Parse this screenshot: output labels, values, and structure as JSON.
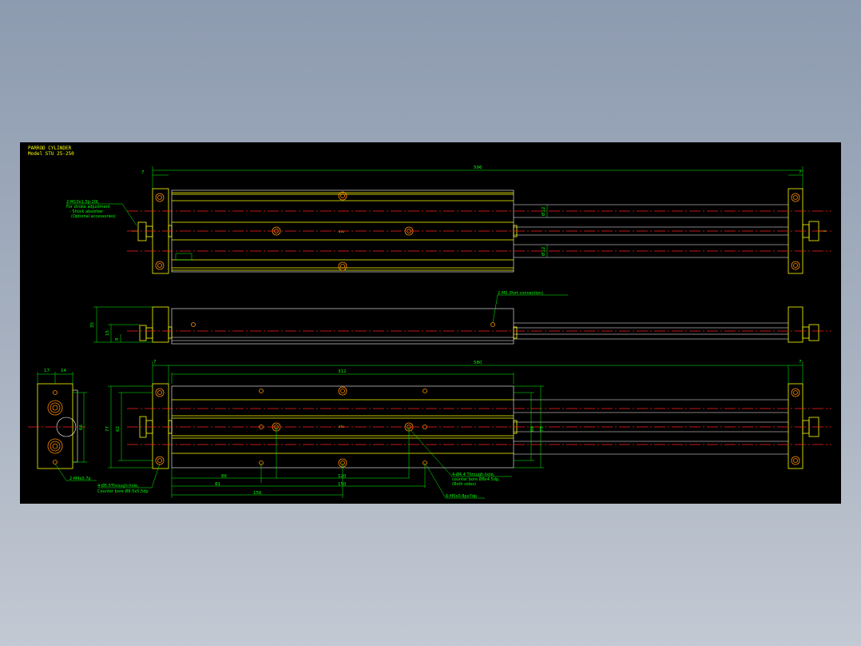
{
  "title": {
    "line1": "PARROD CYLINDER",
    "line2": "Model  STU 25-250"
  },
  "dimensions": {
    "top_overall": "596",
    "top_left_end": "7",
    "top_right_end": "7",
    "top_v1": "Ø12",
    "top_v2": "Ø12",
    "side_h1": "35",
    "side_h2": "15",
    "side_h3": "8",
    "bottom_overall": "580",
    "bottom_left_end": "7",
    "bottom_right_end": "7",
    "bottom_312": "312",
    "bottom_height_outer": "77",
    "bottom_height_inner": "62",
    "bottom_right_66": "66",
    "bottom_right_75": "75",
    "dim_86": "86",
    "dim_120": "120",
    "dim_81": "81",
    "dim_150": "150",
    "dim_156": "156",
    "end_17": "17",
    "end_14": "14",
    "end_66": "66"
  },
  "notes": {
    "n1_l1": "2-M10x1.0p-20L",
    "n1_l2": "For stroke adjustment",
    "n1_l3": "- Shock absorber",
    "n1_l4": "(Optional accessories)",
    "n2": "2-M5 (Port connection)",
    "n3": "2-M4x0.7p",
    "n4_l1": "4-Ø5.5Through-hole,",
    "n4_l2": "Counter bore Ø8.5x5.5dp",
    "n5_l1": "4-Ø4.4 Through-hole,",
    "n5_l2": "counter bore Ø8x4.5dp,",
    "n5_l3": "(Both sides)",
    "n6": "6-M5x0.8px7dp"
  },
  "colors": {
    "background": "#000000",
    "outline": "#ffff00",
    "body": "#ffffff",
    "dimension": "#00ff00",
    "centerline": "#ff2020",
    "hole": "#ff8c00"
  }
}
